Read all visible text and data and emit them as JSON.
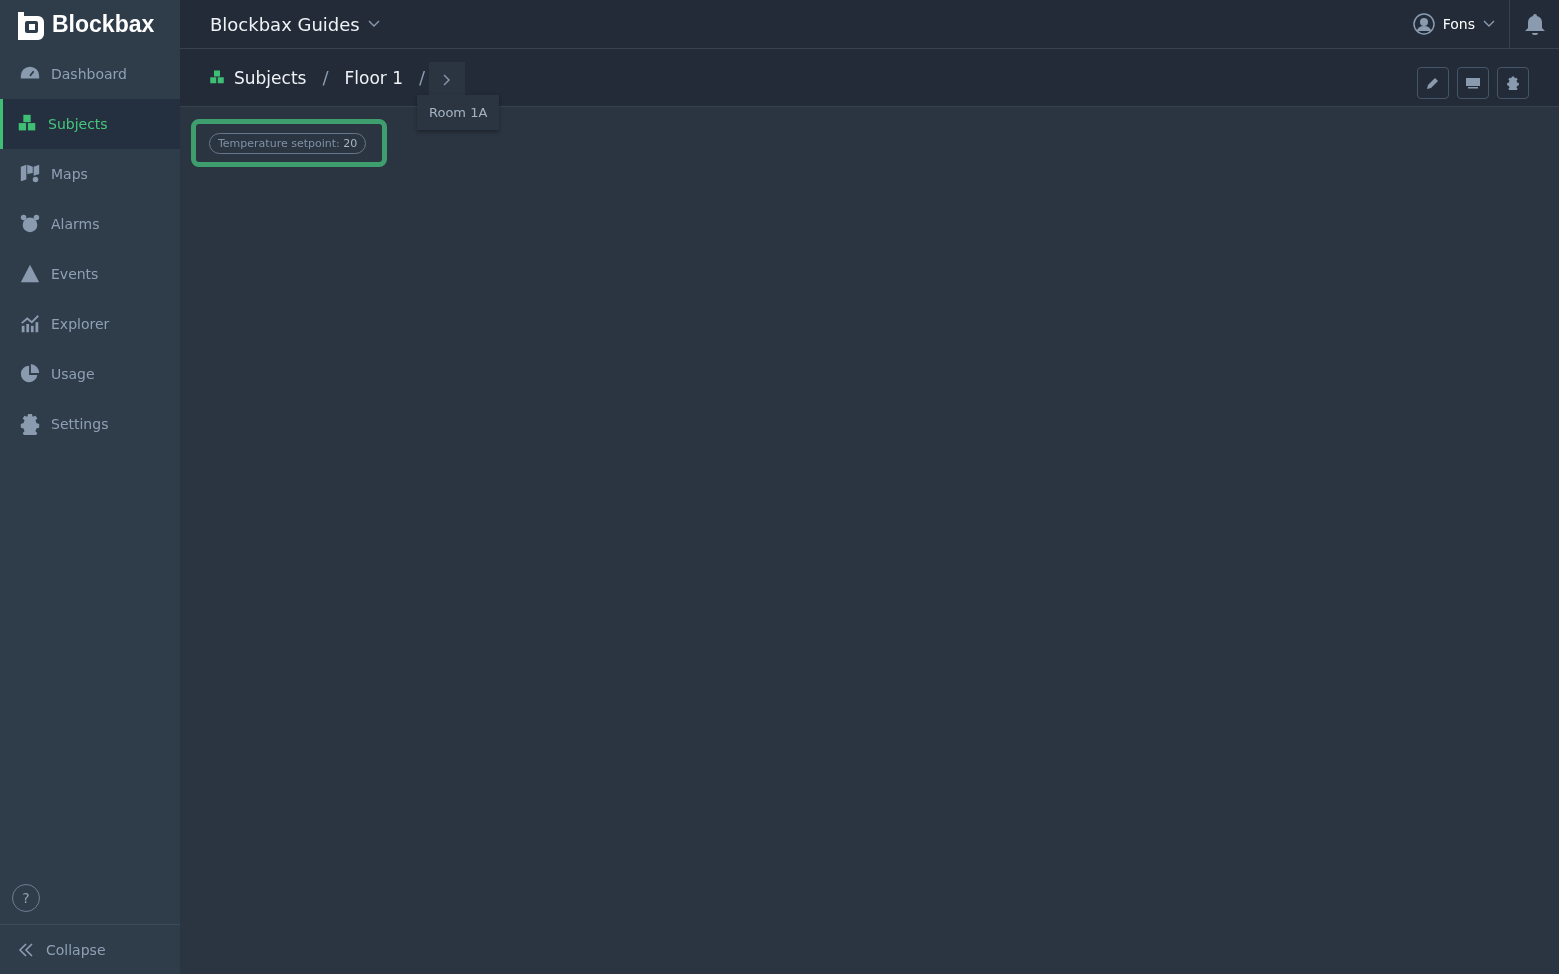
{
  "brand": "Blockbax",
  "sidebar": {
    "items": [
      {
        "label": "Dashboard",
        "selected": false
      },
      {
        "label": "Subjects",
        "selected": true
      },
      {
        "label": "Maps",
        "selected": false
      },
      {
        "label": "Alarms",
        "selected": false
      },
      {
        "label": "Events",
        "selected": false
      },
      {
        "label": "Explorer",
        "selected": false
      },
      {
        "label": "Usage",
        "selected": false
      },
      {
        "label": "Settings",
        "selected": false
      }
    ],
    "help": "?",
    "collapse": "Collapse"
  },
  "topbar": {
    "project": "Blockbax Guides",
    "user": "Fons"
  },
  "breadcrumb": {
    "items": [
      "Subjects",
      "Floor 1"
    ],
    "separators": [
      "/",
      "/"
    ],
    "menu": {
      "expanded": true,
      "items": [
        "Room 1A"
      ]
    }
  },
  "properties": [
    {
      "label": "Temperature setpoint:",
      "value": "20",
      "highlighted": true
    }
  ]
}
